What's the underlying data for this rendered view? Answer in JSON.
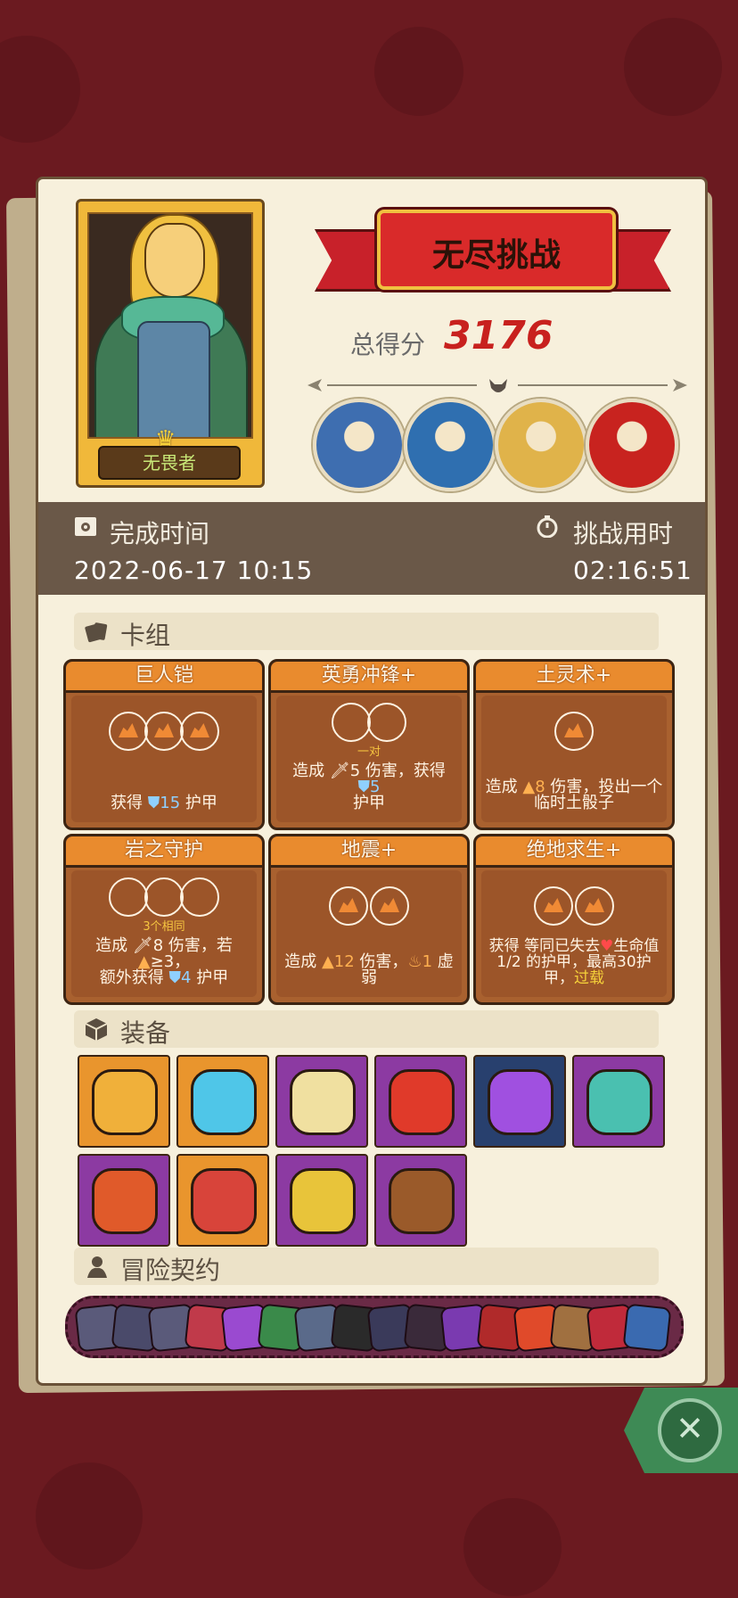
{
  "mode_title": "无尽挑战",
  "hero": {
    "title": "无畏者"
  },
  "score": {
    "label": "总得分",
    "value": "3176"
  },
  "bosses": [
    {
      "name": "mushroom-elder-portrait",
      "color": "#3e6eb0"
    },
    {
      "name": "crowned-specter-portrait",
      "color": "#2f6fb0"
    },
    {
      "name": "serpent-portrait",
      "color": "#e0b34a"
    },
    {
      "name": "red-jester-portrait",
      "color": "#c8231f"
    }
  ],
  "completion": {
    "label": "完成时间",
    "value": "2022-06-17  10:15"
  },
  "duration": {
    "label": "挑战用时",
    "value": "02:16:51"
  },
  "deck": {
    "label": "卡组",
    "cards": [
      {
        "title": "巨人铠",
        "note": "",
        "desc_pre": "获得 ",
        "desc_num": "15",
        "desc_post": " 护甲"
      },
      {
        "title": "英勇冲锋+",
        "note": "一对",
        "desc_pre": "造成 ",
        "desc_num": "5",
        "desc_mid": " 伤害，获得 ",
        "desc_num2": "5",
        "desc_post": "护甲"
      },
      {
        "title": "土灵术+",
        "note": "",
        "desc_pre": "造成 ",
        "desc_num": "8",
        "desc_post": " 伤害，投出一个临时土骰子"
      },
      {
        "title": "岩之守护",
        "note": "3个相同",
        "desc_pre": "造成 ",
        "desc_num": "8",
        "desc_mid": " 伤害，若",
        "desc_num2": "≥3，",
        "desc_line2_pre": "额外获得 ",
        "desc_num3": "4",
        "desc_post": " 护甲"
      },
      {
        "title": "地震+",
        "note": "",
        "desc_pre": "造成 ",
        "desc_num": "12",
        "desc_mid": " 伤害，",
        "desc_num2": "1",
        "desc_post": " 虚弱"
      },
      {
        "title": "绝地求生+",
        "note": "",
        "desc_pre": "获得 等同已失去",
        "desc_mid": "生命值1/2 的护甲，最高30护甲，",
        "desc_post": "过载"
      }
    ]
  },
  "equipment": {
    "label": "装备",
    "items": [
      {
        "name": "sweater-icon",
        "bg": "orange",
        "color": "#f0b03a"
      },
      {
        "name": "ice-shield-icon",
        "bg": "orange",
        "color": "#4fc6e8"
      },
      {
        "name": "mirror-icon",
        "bg": "purple",
        "color": "#f0e0a0"
      },
      {
        "name": "dragon-dagger-icon",
        "bg": "purple",
        "color": "#e03a2a"
      },
      {
        "name": "potion-flask-icon",
        "bg": "navy",
        "color": "#a050e0"
      },
      {
        "name": "lion-shield-icon",
        "bg": "purple",
        "color": "#4ac0b0"
      },
      {
        "name": "spiked-bracer-icon",
        "bg": "purple",
        "color": "#e05a2a"
      },
      {
        "name": "spiked-armor-icon",
        "bg": "orange",
        "color": "#d8443a"
      },
      {
        "name": "emerald-ring-icon",
        "bg": "purple",
        "color": "#e8c43a"
      },
      {
        "name": "leather-bracer-icon",
        "bg": "purple",
        "color": "#9a5a2a"
      }
    ]
  },
  "contracts": {
    "label": "冒险契约",
    "items": [
      {
        "name": "swirl-contract-icon",
        "color": "#5a5a7a"
      },
      {
        "name": "skull-contract-icon",
        "color": "#4a4a6a"
      },
      {
        "name": "scroll-contract-icon",
        "color": "#5a5a7a"
      },
      {
        "name": "heart-lock-contract-icon",
        "color": "#c03a4a"
      },
      {
        "name": "shield-gear-contract-icon",
        "color": "#9a4ad0"
      },
      {
        "name": "green-monster-contract-icon",
        "color": "#3a8a4a"
      },
      {
        "name": "fist-contract-icon",
        "color": "#5a6a8a"
      },
      {
        "name": "ring-contract-icon",
        "color": "#2a2a2a"
      },
      {
        "name": "skull-pile-contract-icon",
        "color": "#3a3a5a"
      },
      {
        "name": "fanged-maw-contract-icon",
        "color": "#3a2a3a"
      },
      {
        "name": "purple-demon-contract-icon",
        "color": "#7a3ab0"
      },
      {
        "name": "red-shield-contract-icon",
        "color": "#b02a2a"
      },
      {
        "name": "red-dragon-contract-icon",
        "color": "#e04a2a"
      },
      {
        "name": "hourglass-contract-icon",
        "color": "#a07040"
      },
      {
        "name": "red-devil-contract-icon",
        "color": "#c02a3a"
      },
      {
        "name": "blue-mushroom-contract-icon",
        "color": "#3a6ab0"
      }
    ]
  }
}
